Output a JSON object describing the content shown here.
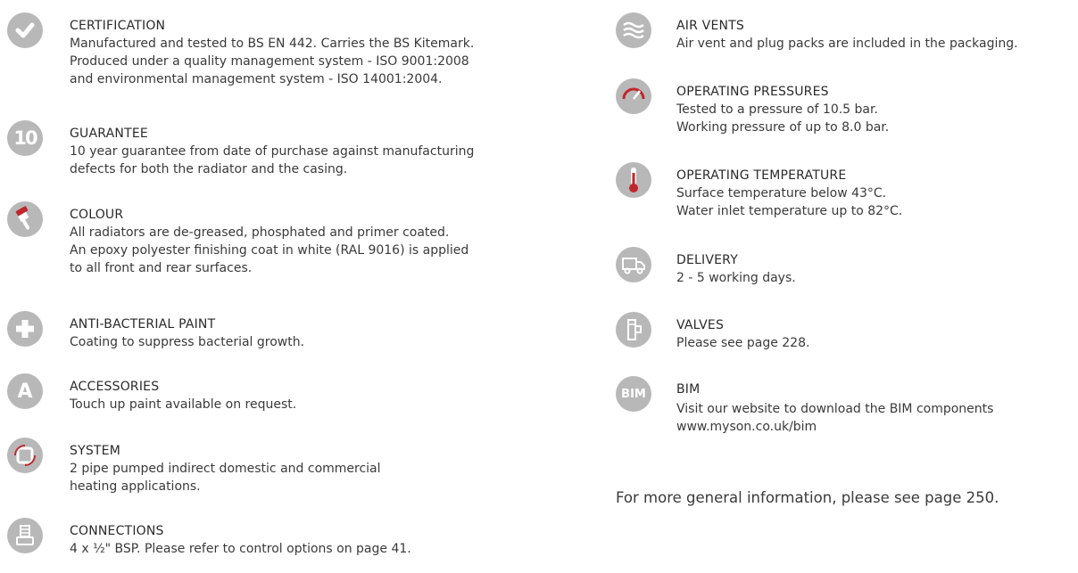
{
  "left": [
    {
      "id": "certification",
      "icon": "checkmark-icon",
      "title": "CERTIFICATION",
      "lines": [
        "Manufactured and tested to BS EN 442. Carries the BS Kitemark.",
        "Produced under a quality management system - ISO 9001:2008",
        "and environmental management system - ISO 14001:2004."
      ]
    },
    {
      "id": "guarantee",
      "icon": "ten-year-icon",
      "icon_text": "10",
      "title": "GUARANTEE",
      "lines": [
        "10 year guarantee from date of purchase against manufacturing",
        "defects for both the radiator and the casing."
      ]
    },
    {
      "id": "colour",
      "icon": "paintbrush-icon",
      "title": "COLOUR",
      "lines": [
        "All radiators are de-greased, phosphated and primer coated.",
        "An epoxy polyester finishing coat in white (RAL 9016) is applied",
        "to all front and rear surfaces."
      ]
    },
    {
      "id": "anti-bacterial-paint",
      "icon": "plus-icon",
      "title": "ANTI-BACTERIAL PAINT",
      "lines": [
        "Coating to suppress bacterial growth."
      ]
    },
    {
      "id": "accessories",
      "icon": "letter-a-icon",
      "icon_text": "A",
      "title": "ACCESSORIES",
      "lines": [
        "Touch up paint available on request."
      ]
    },
    {
      "id": "system",
      "icon": "system-cycle-icon",
      "title": "SYSTEM",
      "lines": [
        "2 pipe pumped indirect domestic and commercial",
        "heating applications."
      ]
    },
    {
      "id": "connections",
      "icon": "connection-valve-icon",
      "title": "CONNECTIONS",
      "lines": [
        "4 x ½\" BSP. Please refer to control options on page 41."
      ]
    }
  ],
  "right": [
    {
      "id": "air-vents",
      "icon": "air-waves-icon",
      "title": "AIR VENTS",
      "lines": [
        "Air vent and plug packs are included in the packaging."
      ]
    },
    {
      "id": "operating-pressures",
      "icon": "pressure-gauge-icon",
      "title": "OPERATING PRESSURES",
      "lines": [
        "Tested to a pressure of 10.5 bar.",
        "Working pressure of up to 8.0 bar."
      ]
    },
    {
      "id": "operating-temperature",
      "icon": "thermometer-icon",
      "title": "OPERATING TEMPERATURE",
      "lines": [
        "Surface temperature below 43°C.",
        "Water inlet temperature up to 82°C."
      ]
    },
    {
      "id": "delivery",
      "icon": "delivery-truck-icon",
      "title": "DELIVERY",
      "lines": [
        "2 - 5 working days."
      ]
    },
    {
      "id": "valves",
      "icon": "valve-icon",
      "title": "VALVES",
      "lines": [
        "Please see page 228."
      ]
    },
    {
      "id": "bim",
      "icon": "bim-icon",
      "icon_text": "BIM",
      "title": "BIM",
      "lines": [
        "",
        "Visit our website to download the BIM components",
        "www.myson.co.uk/bim"
      ]
    }
  ],
  "footer": "For more general information, please see page 250.",
  "colors": {
    "icon_grey": "#b8b8b8",
    "accent_red": "#c0272d",
    "text": "#3a3a3a"
  }
}
